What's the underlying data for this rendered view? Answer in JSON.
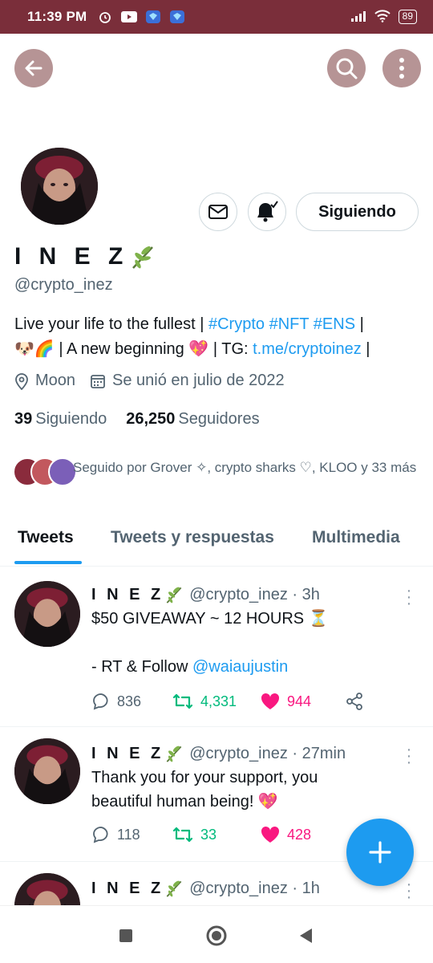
{
  "status_bar": {
    "time": "11:39 PM",
    "battery": "89",
    "bg_color": "#7a2e3a",
    "icons": [
      "alarm-icon",
      "youtube-icon",
      "game-icon",
      "game-icon",
      "signal-icon",
      "wifi-icon"
    ]
  },
  "profile": {
    "display_name": "I N E Z",
    "handle": "@crypto_inez",
    "bio_line1_text": "Live your life to the fullest | ",
    "bio_tag_crypto": "#Crypto",
    "bio_tag_nft": "#NFT",
    "bio_tag_ens": "#ENS",
    "bio_sep": " |",
    "bio_emoji1": "🐶🌈",
    "bio_line2_text": " | A new beginning ",
    "bio_emoji2": "💖",
    "bio_tg": " | TG: ",
    "bio_tg_link": "t.me/cryptoinez",
    "bio_end": " |",
    "location": "Moon",
    "joined": "Se unió en julio de 2022",
    "following_count": "39",
    "following_label": "Siguiendo",
    "followers_count": "26,250",
    "followers_label": "Seguidores",
    "followed_by": "Seguido por Grover ✧, crypto sharks ♡, KLOO y 33 más",
    "follow_button": "Siguiendo"
  },
  "tabs": [
    {
      "label": "Tweets",
      "active": true
    },
    {
      "label": "Tweets y respuestas",
      "active": false
    },
    {
      "label": "Multimedia",
      "active": false
    }
  ],
  "tweets": [
    {
      "name": "I N E Z",
      "handle": "@crypto_inez",
      "time": "· 3h",
      "line1": "$50 GIVEAWAY ~ 12 HOURS ⏳",
      "line3_text": "- RT & Follow ",
      "line3_link": "@waiaujustin",
      "replies": "836",
      "retweets": "4,331",
      "likes": "944"
    },
    {
      "name": "I N E Z",
      "handle": "@crypto_inez",
      "time": "· 27min",
      "line1": "Thank you for your support, you",
      "line2": "beautiful human being! 💖",
      "replies": "118",
      "retweets": "33",
      "likes": "428"
    },
    {
      "name": "I N E Z",
      "handle": "@crypto_inez",
      "time": "· 1h"
    }
  ],
  "colors": {
    "accent": "#1d9bf0",
    "retweet": "#00ba7c",
    "like": "#f91880",
    "circle_button": "#b69495"
  }
}
